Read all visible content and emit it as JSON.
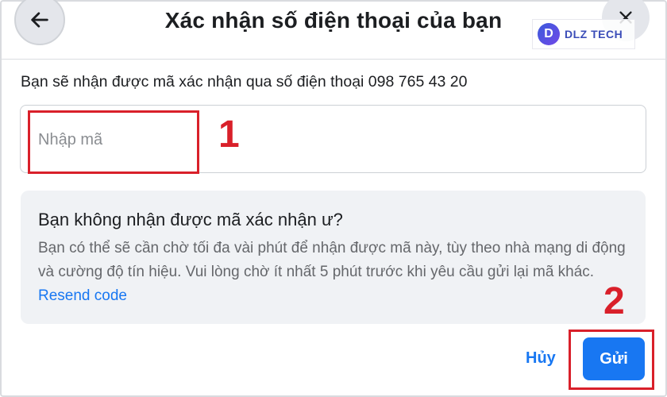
{
  "dialog": {
    "title": "Xác nhận số điện thoại của bạn"
  },
  "watermark": {
    "logo_letter": "D",
    "text": "DLZ TECH"
  },
  "intro": {
    "text": "Bạn sẽ nhận được mã xác nhận qua số điện thoại 098 765 43 20"
  },
  "code_input": {
    "placeholder": "Nhập mã",
    "value": ""
  },
  "help": {
    "title": "Bạn không nhận được mã xác nhận ư?",
    "body": "Bạn có thể sẽ cần chờ tối đa vài phút để nhận được mã này, tùy theo nhà mạng di động và cường độ tín hiệu. Vui lòng chờ ít nhất 5 phút trước khi yêu cầu gửi lại mã khác. ",
    "link": "Resend code"
  },
  "annotations": {
    "step1": "1",
    "step2": "2",
    "highlight_color": "#d9202a"
  },
  "actions": {
    "cancel_label": "Hủy",
    "send_label": "Gửi"
  },
  "colors": {
    "accent": "#1877f2",
    "text": "#1c1e21",
    "muted": "#65676b",
    "panel": "#f0f2f5"
  },
  "icons": {
    "back": "arrow-left-icon",
    "close": "close-icon"
  }
}
